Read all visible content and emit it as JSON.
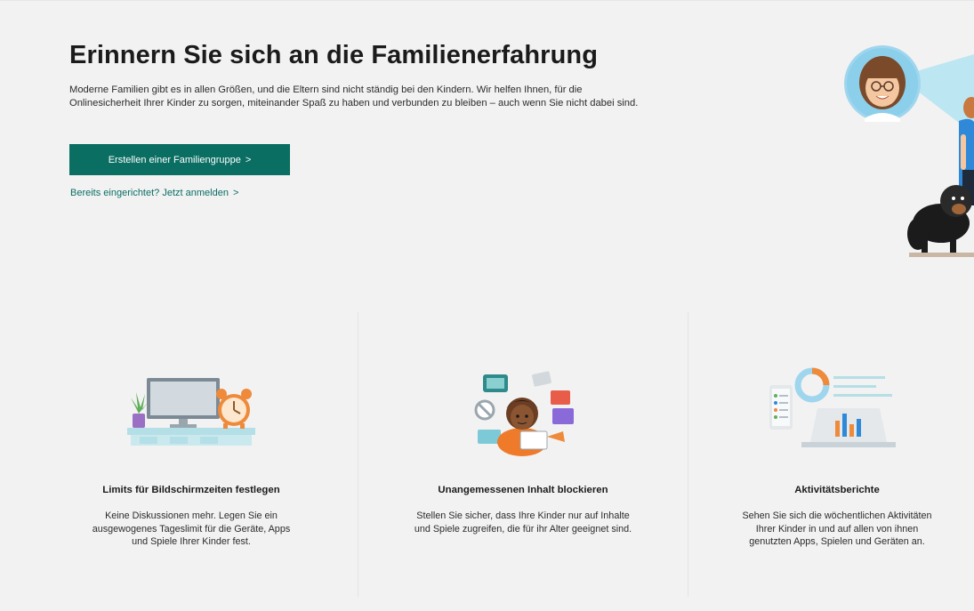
{
  "hero": {
    "title": "Erinnern Sie sich an die Familienerfahrung",
    "description": "Moderne Familien gibt es in allen Größen, und die Eltern sind nicht ständig bei den Kindern. Wir helfen Ihnen, für die Onlinesicherheit Ihrer Kinder zu sorgen, miteinander Spaß zu haben und verbunden zu bleiben – auch wenn Sie nicht dabei sind.",
    "cta_label": "Erstellen einer Familiengruppe",
    "cta_chevron": ">",
    "signin_label": "Bereits eingerichtet? Jetzt anmelden",
    "signin_chevron": ">"
  },
  "features": [
    {
      "title": "Limits für Bildschirmzeiten festlegen",
      "description": "Keine Diskussionen mehr. Legen Sie ein ausgewogenes Tageslimit für die Geräte, Apps und Spiele Ihrer Kinder fest.",
      "icon": "monitor-alarm-clock-illustration"
    },
    {
      "title": "Unangemessenen Inhalt blockieren",
      "description": "Stellen Sie sicher, dass Ihre Kinder nur auf Inhalte und Spiele zugreifen, die für ihr Alter geeignet sind.",
      "icon": "child-blocked-content-illustration"
    },
    {
      "title": "Aktivitätsberichte",
      "description": "Sehen Sie sich die wöchentlichen Aktivitäten Ihrer Kinder in und auf allen von ihnen genutzten Apps, Spielen und Geräten an.",
      "icon": "activity-report-illustration"
    }
  ],
  "colors": {
    "accent": "#0a6e63",
    "background": "#f2f2f2",
    "text": "#1b1b1b"
  }
}
